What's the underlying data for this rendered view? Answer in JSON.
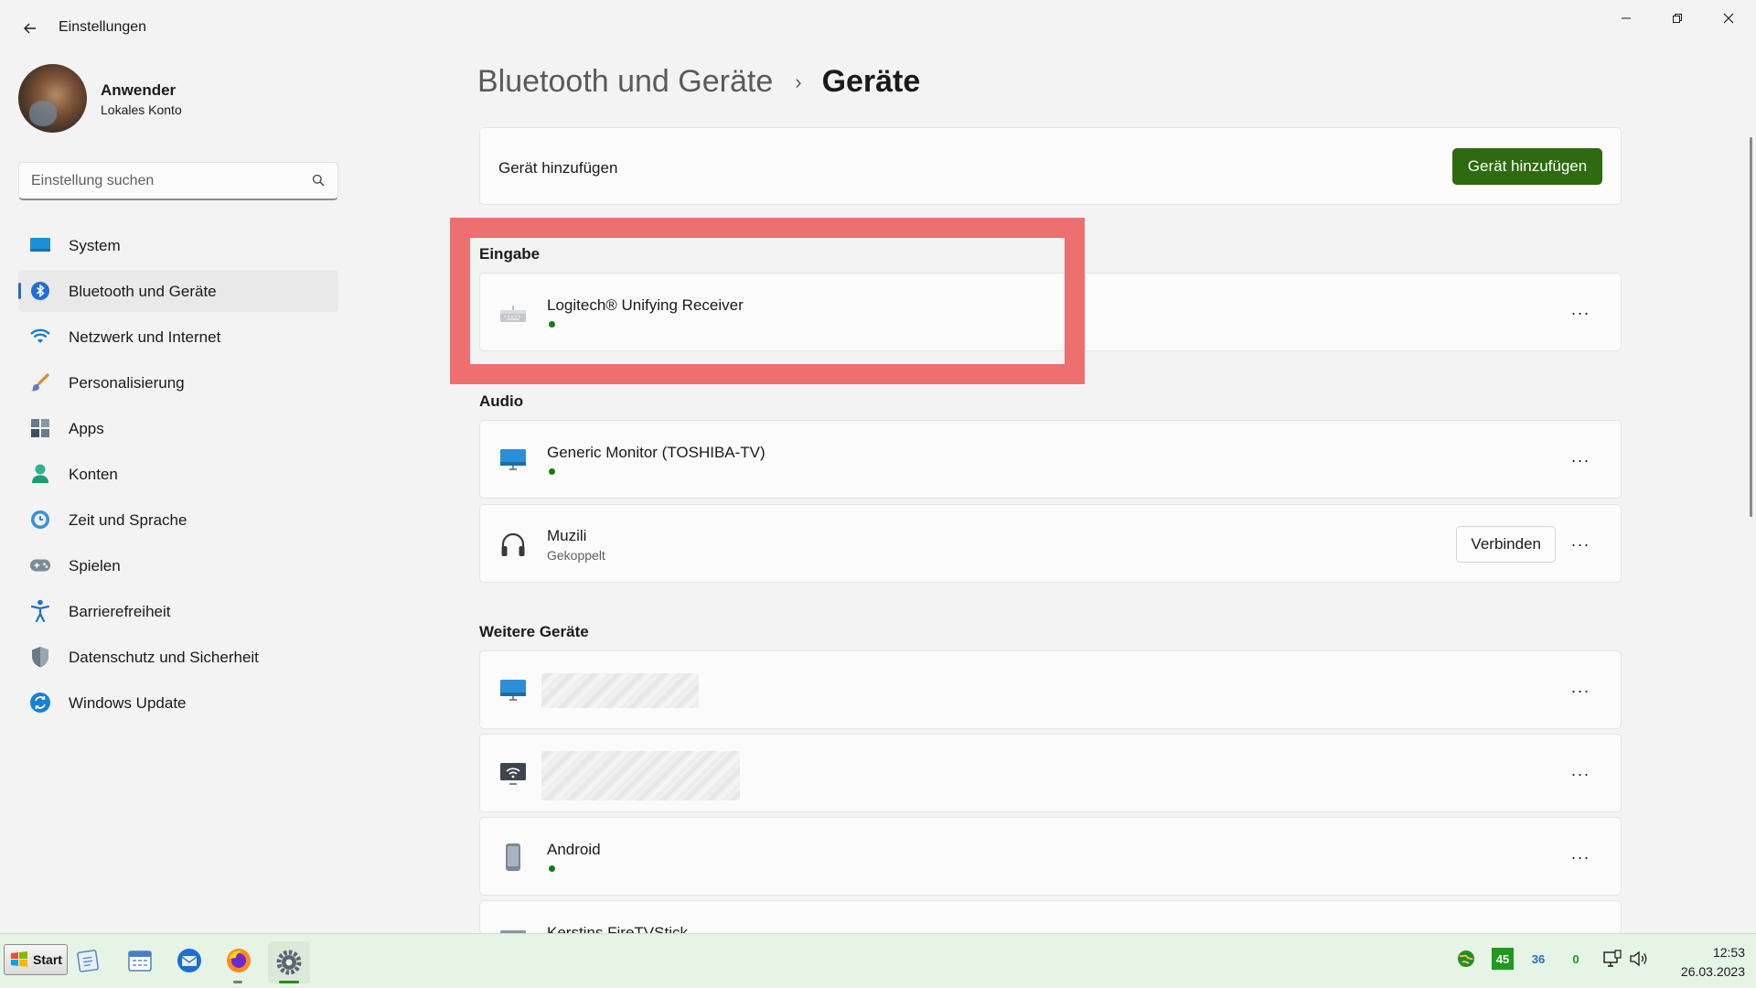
{
  "window": {
    "title": "Einstellungen"
  },
  "profile": {
    "name": "Anwender",
    "account_type": "Lokales Konto"
  },
  "search": {
    "placeholder": "Einstellung suchen"
  },
  "sidebar": {
    "items": [
      {
        "label": "System",
        "icon": "monitor-icon"
      },
      {
        "label": "Bluetooth und Geräte",
        "icon": "bluetooth-icon",
        "active": true
      },
      {
        "label": "Netzwerk und Internet",
        "icon": "wifi-icon"
      },
      {
        "label": "Personalisierung",
        "icon": "brush-icon"
      },
      {
        "label": "Apps",
        "icon": "apps-icon"
      },
      {
        "label": "Konten",
        "icon": "person-icon"
      },
      {
        "label": "Zeit und Sprache",
        "icon": "clock-globe-icon"
      },
      {
        "label": "Spielen",
        "icon": "gamepad-icon"
      },
      {
        "label": "Barrierefreiheit",
        "icon": "accessibility-icon"
      },
      {
        "label": "Datenschutz und Sicherheit",
        "icon": "shield-icon"
      },
      {
        "label": "Windows Update",
        "icon": "update-icon"
      }
    ]
  },
  "breadcrumb": {
    "parent": "Bluetooth und Geräte",
    "separator": "›",
    "current": "Geräte"
  },
  "add_device": {
    "label": "Gerät hinzufügen",
    "button": "Gerät hinzufügen"
  },
  "sections": {
    "input": {
      "title": "Eingabe",
      "devices": [
        {
          "name": "Logitech® Unifying Receiver",
          "icon": "keyboard-icon",
          "connected": true
        }
      ]
    },
    "audio": {
      "title": "Audio",
      "devices": [
        {
          "name": "Generic Monitor (TOSHIBA-TV)",
          "icon": "monitor-icon",
          "connected": true
        },
        {
          "name": "Muzili",
          "status": "Gekoppelt",
          "icon": "headphones-icon",
          "action": "Verbinden"
        }
      ]
    },
    "other": {
      "title": "Weitere Geräte",
      "devices": [
        {
          "name": "",
          "icon": "monitor-icon",
          "redacted": true
        },
        {
          "name": "",
          "icon": "wireless-display-icon",
          "redacted": true
        },
        {
          "name": "Android",
          "icon": "phone-icon",
          "connected": true
        },
        {
          "name": "Kerstins FireTVStick",
          "icon": "tv-icon",
          "partial": true
        }
      ]
    }
  },
  "more_label": "···",
  "taskbar": {
    "start_label": "Start",
    "apps": [
      "notepad-icon",
      "calendar-icon",
      "thunderbird-icon",
      "firefox-icon",
      "settings-icon"
    ],
    "tray": {
      "counter_a": "45",
      "counter_b": "36",
      "counter_c": "0"
    },
    "clock": {
      "time": "12:53",
      "date": "26.03.2023"
    }
  },
  "colors": {
    "accent": "#2d6a10",
    "highlight": "#ee6f6f",
    "status_dot": "#107c10",
    "nav_indicator": "#2b6ac1"
  }
}
